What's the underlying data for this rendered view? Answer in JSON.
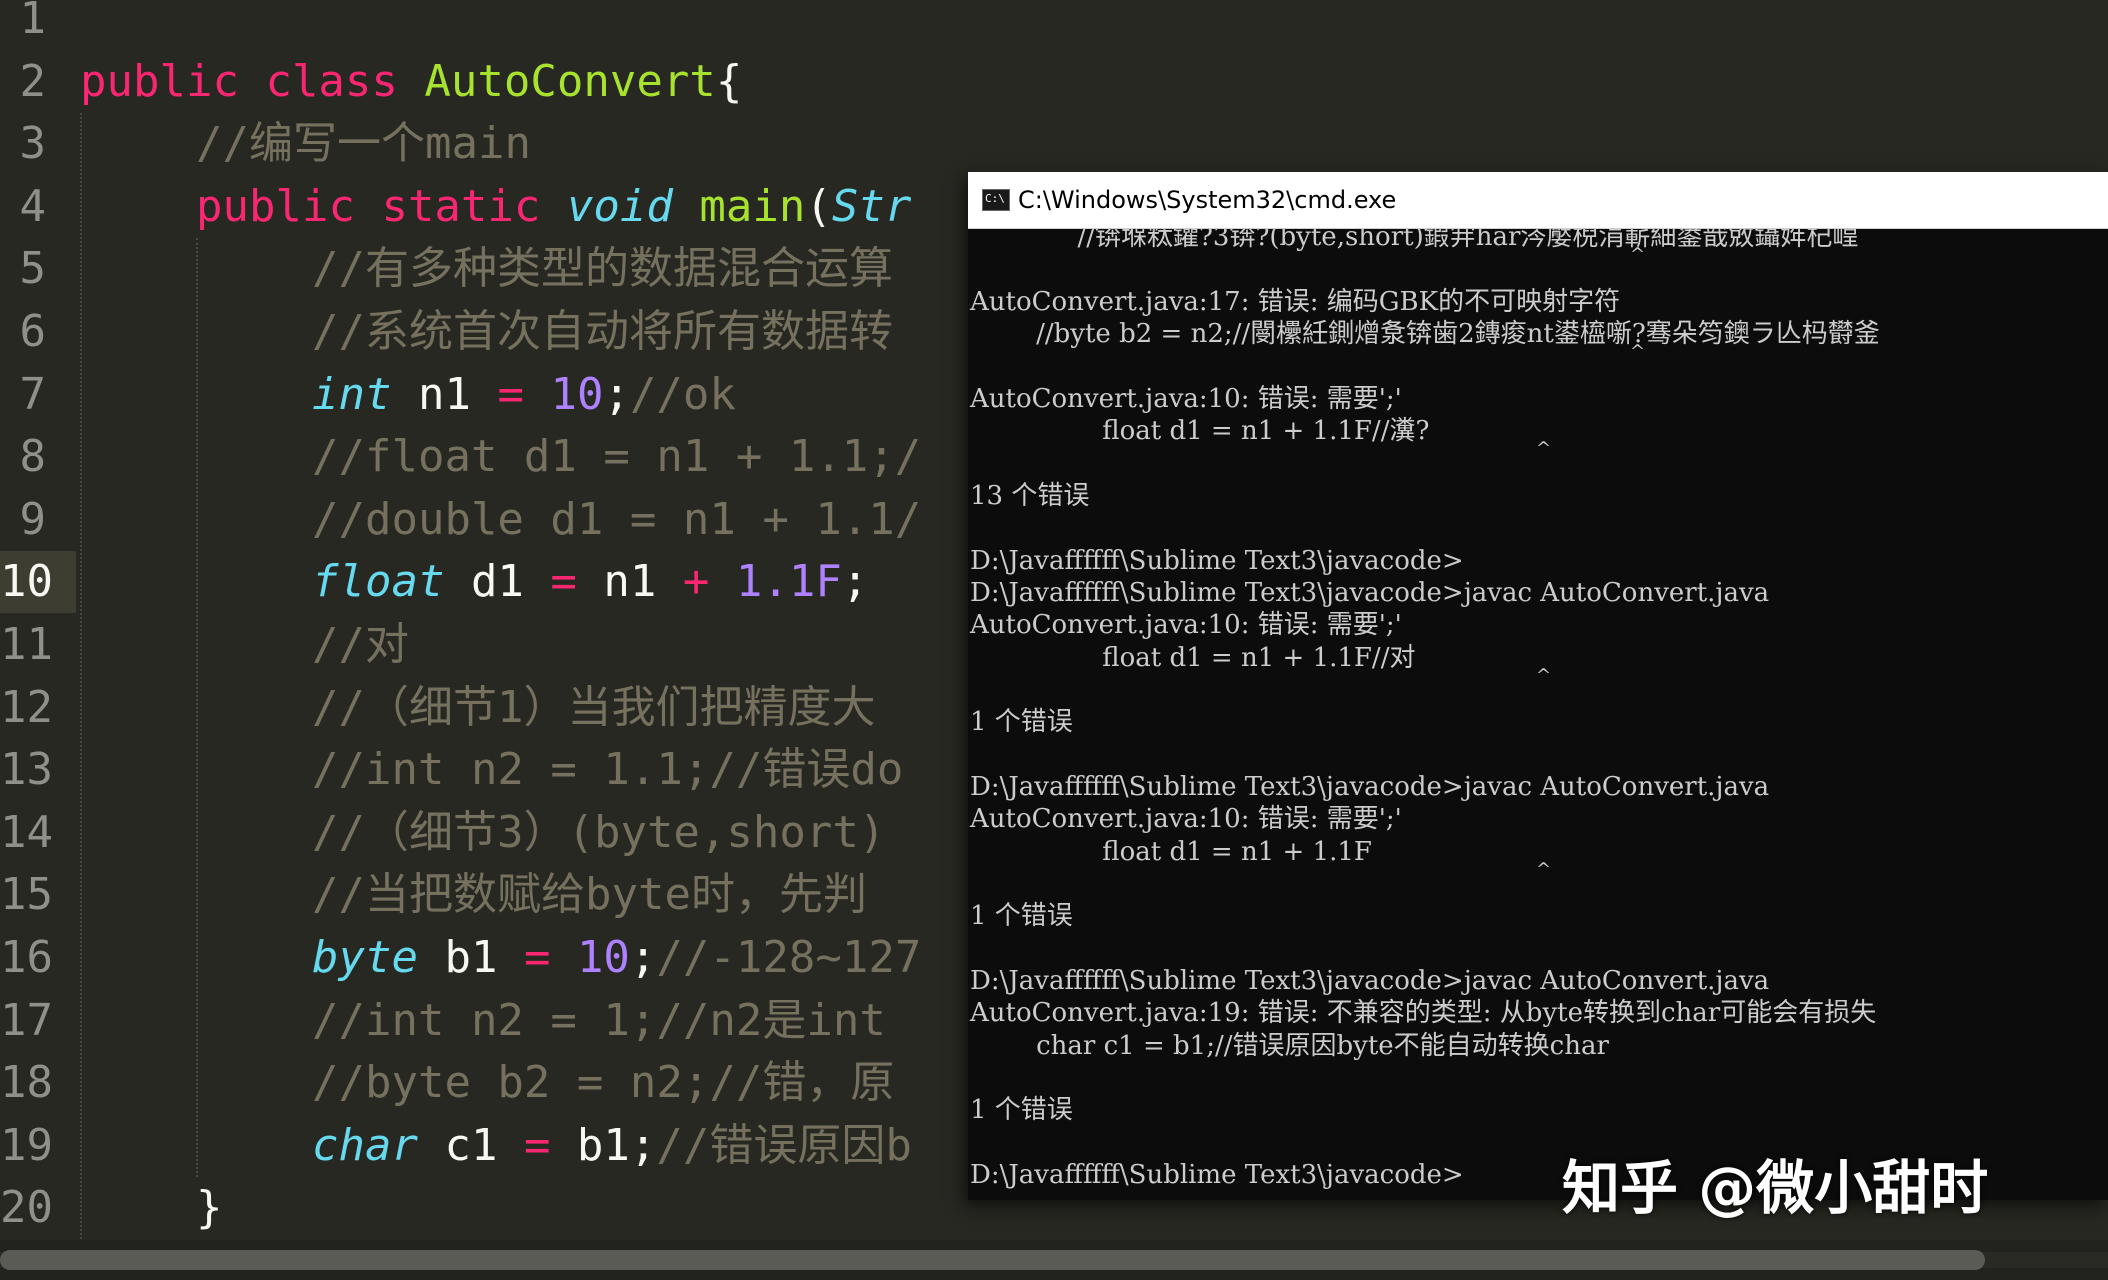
{
  "editor": {
    "active_line": "10",
    "line_numbers": [
      "1",
      "2",
      "3",
      "4",
      "5",
      "6",
      "7",
      "8",
      "9",
      "10",
      "11",
      "12",
      "13",
      "14",
      "15",
      "16",
      "17",
      "18",
      "19",
      "20"
    ],
    "lines": [
      [],
      [
        {
          "t": "public",
          "c": "kw"
        },
        {
          "t": " ",
          "c": "id"
        },
        {
          "t": "class",
          "c": "kw"
        },
        {
          "t": " ",
          "c": "id"
        },
        {
          "t": "AutoConvert",
          "c": "cls"
        },
        {
          "t": "{",
          "c": "id"
        }
      ],
      [
        {
          "t": "//编写一个main",
          "c": "cm"
        }
      ],
      [
        {
          "t": "public",
          "c": "kw"
        },
        {
          "t": " ",
          "c": "id"
        },
        {
          "t": "static",
          "c": "kw"
        },
        {
          "t": " ",
          "c": "id"
        },
        {
          "t": "void",
          "c": "ty"
        },
        {
          "t": " ",
          "c": "id"
        },
        {
          "t": "main",
          "c": "fn"
        },
        {
          "t": "(",
          "c": "id"
        },
        {
          "t": "Str",
          "c": "ty"
        }
      ],
      [
        {
          "t": "//有多种类型的数据混合运算",
          "c": "cm"
        }
      ],
      [
        {
          "t": "//系统首次自动将所有数据转",
          "c": "cm"
        }
      ],
      [
        {
          "t": "int",
          "c": "ty"
        },
        {
          "t": " n1 ",
          "c": "id"
        },
        {
          "t": "=",
          "c": "op"
        },
        {
          "t": " ",
          "c": "id"
        },
        {
          "t": "10",
          "c": "num"
        },
        {
          "t": ";",
          "c": "id"
        },
        {
          "t": "//ok",
          "c": "cm"
        }
      ],
      [
        {
          "t": "//float d1 = n1 + 1.1;/",
          "c": "cm"
        }
      ],
      [
        {
          "t": "//double d1 = n1 + 1.1/",
          "c": "cm"
        }
      ],
      [
        {
          "t": "float",
          "c": "ty"
        },
        {
          "t": " d1 ",
          "c": "id"
        },
        {
          "t": "=",
          "c": "op"
        },
        {
          "t": " n1 ",
          "c": "id"
        },
        {
          "t": "+",
          "c": "op"
        },
        {
          "t": " ",
          "c": "id"
        },
        {
          "t": "1.1F",
          "c": "num"
        },
        {
          "t": ";",
          "c": "id"
        }
      ],
      [
        {
          "t": "//对",
          "c": "cm"
        }
      ],
      [
        {
          "t": "//（细节1）当我们把精度大",
          "c": "cm"
        }
      ],
      [
        {
          "t": "//int n2 = 1.1;//错误do",
          "c": "cm"
        }
      ],
      [
        {
          "t": "//（细节3）(byte,short)",
          "c": "cm"
        }
      ],
      [
        {
          "t": "//当把数赋给byte时，先判",
          "c": "cm"
        }
      ],
      [
        {
          "t": "byte",
          "c": "ty"
        },
        {
          "t": " b1 ",
          "c": "id"
        },
        {
          "t": "=",
          "c": "op"
        },
        {
          "t": " ",
          "c": "id"
        },
        {
          "t": "10",
          "c": "num"
        },
        {
          "t": ";",
          "c": "id"
        },
        {
          "t": "//-128~127",
          "c": "cm"
        }
      ],
      [
        {
          "t": "//int n2 = 1;//n2是int",
          "c": "cm"
        }
      ],
      [
        {
          "t": "//byte b2 = n2;//错，原",
          "c": "cm"
        }
      ],
      [
        {
          "t": "char",
          "c": "ty"
        },
        {
          "t": " c1 ",
          "c": "id"
        },
        {
          "t": "=",
          "c": "op"
        },
        {
          "t": " b1;",
          "c": "id"
        },
        {
          "t": "//错误原因b",
          "c": "cm"
        }
      ],
      [
        {
          "t": "}",
          "c": "id"
        }
      ]
    ]
  },
  "cmd": {
    "title": "C:\\Windows\\System32\\cmd.exe",
    "icon": "cmd-app-icon",
    "lines": [
      "             //锛堢粏鑺?3锛?(byte,short)鍜宑har涔嬮棿涓嶄細鍙戠敓鑷姩杞崲",
      "",
      "AutoConvert.java:17: 错误: 编码GBK的不可映射字符",
      "        //byte b2 = n2;//閿欙紝鍘熷洜锛歯2鏄痠nt鍙橀噺?骞朵笉鐭ラ亾杩欎釜",
      "",
      "AutoConvert.java:10: 错误: 需要';'",
      "                float d1 = n1 + 1.1F//瀵?",
      "",
      "13 个错误",
      "",
      "D:\\Javaffffff\\Sublime Text3\\javacode>",
      "D:\\Javaffffff\\Sublime Text3\\javacode>javac AutoConvert.java",
      "AutoConvert.java:10: 错误: 需要';'",
      "                float d1 = n1 + 1.1F//对",
      "",
      "1 个错误",
      "",
      "D:\\Javaffffff\\Sublime Text3\\javacode>javac AutoConvert.java",
      "AutoConvert.java:10: 错误: 需要';'",
      "                float d1 = n1 + 1.1F",
      "",
      "1 个错误",
      "",
      "D:\\Javaffffff\\Sublime Text3\\javacode>javac AutoConvert.java",
      "AutoConvert.java:19: 错误: 不兼容的类型: 从byte转换到char可能会有损失",
      "        char c1 = b1;//错误原因byte不能自动转换char",
      "",
      "1 个错误",
      "",
      "D:\\Javaffffff\\Sublime Text3\\javacode>"
    ],
    "carets": [
      "^",
      "^",
      "^",
      "^",
      "^"
    ]
  },
  "watermark": {
    "text": "知乎 @微小甜时"
  }
}
